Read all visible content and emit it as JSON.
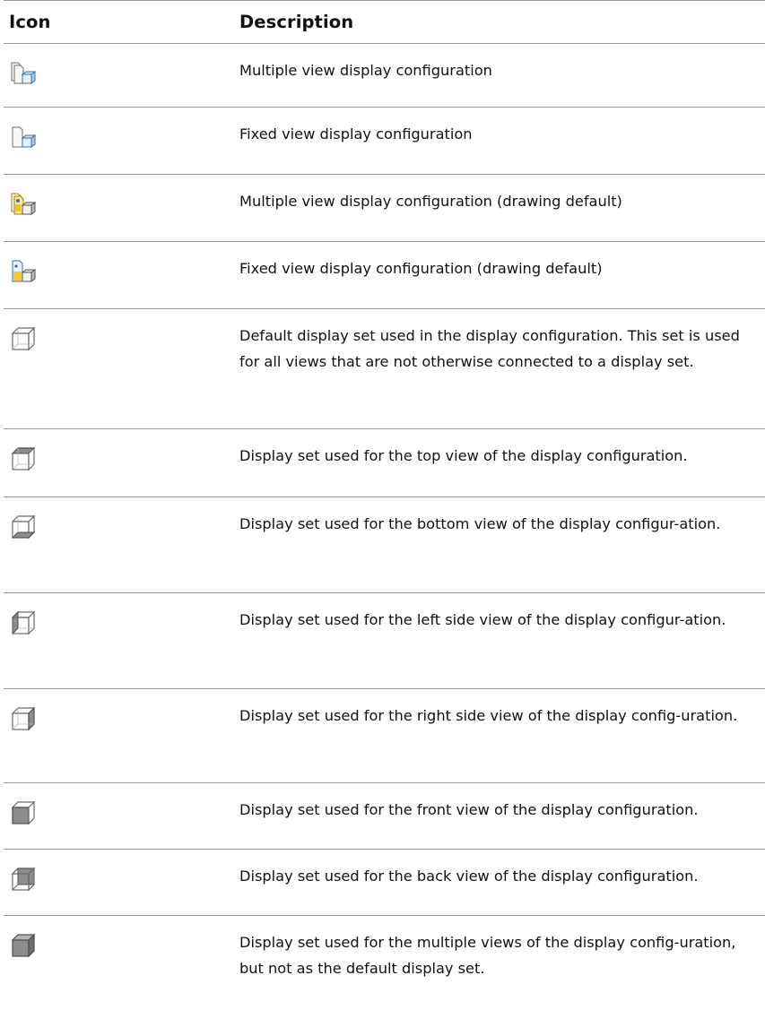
{
  "table": {
    "header_icon": "Icon",
    "header_description": "Description",
    "rows": [
      {
        "icon": "multiple-view-config-icon",
        "description": "Multiple view display configuration"
      },
      {
        "icon": "fixed-view-config-icon",
        "description": "Fixed view display configuration"
      },
      {
        "icon": "multiple-view-config-default-icon",
        "description": "Multiple view display configuration (drawing default)"
      },
      {
        "icon": "fixed-view-config-default-icon",
        "description": "Fixed view display configuration (drawing default)"
      },
      {
        "icon": "default-display-set-icon",
        "description": "Default display set used in the display configuration. This set is used for all views that are not otherwise connected to a display set."
      },
      {
        "icon": "top-view-display-set-icon",
        "description": "Display set used for the top view of the display configuration."
      },
      {
        "icon": "bottom-view-display-set-icon",
        "description": "Display set used for the bottom view of the display configur-ation."
      },
      {
        "icon": "left-view-display-set-icon",
        "description": "Display set used for the left side view of the display configur-ation."
      },
      {
        "icon": "right-view-display-set-icon",
        "description": "Display set used for the right side view of the display config-uration."
      },
      {
        "icon": "front-view-display-set-icon",
        "description": "Display set used for the front view of the display configuration."
      },
      {
        "icon": "back-view-display-set-icon",
        "description": "Display set used for the back view of the display configuration."
      },
      {
        "icon": "multiple-views-display-set-icon",
        "description": "Display set used for the multiple views of the display config-uration, but not as the default display set."
      }
    ]
  }
}
